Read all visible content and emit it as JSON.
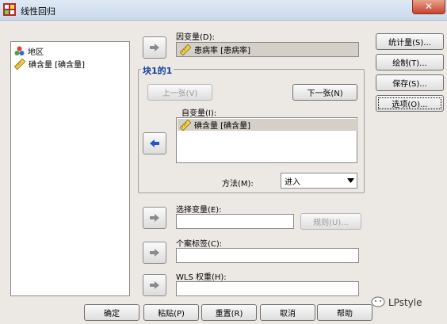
{
  "window": {
    "title": "线性回归",
    "close_glyph": "✕"
  },
  "variables_list": {
    "items": [
      {
        "label": "地区",
        "icon": "nominal-balls-icon"
      },
      {
        "label": "碘含量 [碘含量]",
        "icon": "scale-ruler-icon"
      }
    ]
  },
  "dependent": {
    "label": "因变量(D):",
    "value": "患病率 [患病率]"
  },
  "block": {
    "title": "块1的1",
    "prev_label": "上一张(V)",
    "next_label": "下一张(N)",
    "independent_label": "自变量(I):",
    "independent_items": [
      "碘含量 [碘含量]"
    ],
    "method_label": "方法(M):",
    "method_value": "进入"
  },
  "selection": {
    "label": "选择变量(E):",
    "rule_label": "规则(U)..."
  },
  "case_labels": {
    "label": "个案标签(C):"
  },
  "wls": {
    "label": "WLS 权重(H):"
  },
  "side_buttons": [
    "统计量(S)...",
    "绘制(T)...",
    "保存(S)...",
    "选项(O)..."
  ],
  "bottom_buttons": [
    "确定",
    "粘贴(P)",
    "重置(R)",
    "取消",
    "帮助"
  ],
  "watermark": {
    "text": "LPstyle"
  },
  "colors": {
    "title_accent": "#0c3e9c",
    "arrow_blue": "#2457c5",
    "close_red": "#c7432b"
  }
}
